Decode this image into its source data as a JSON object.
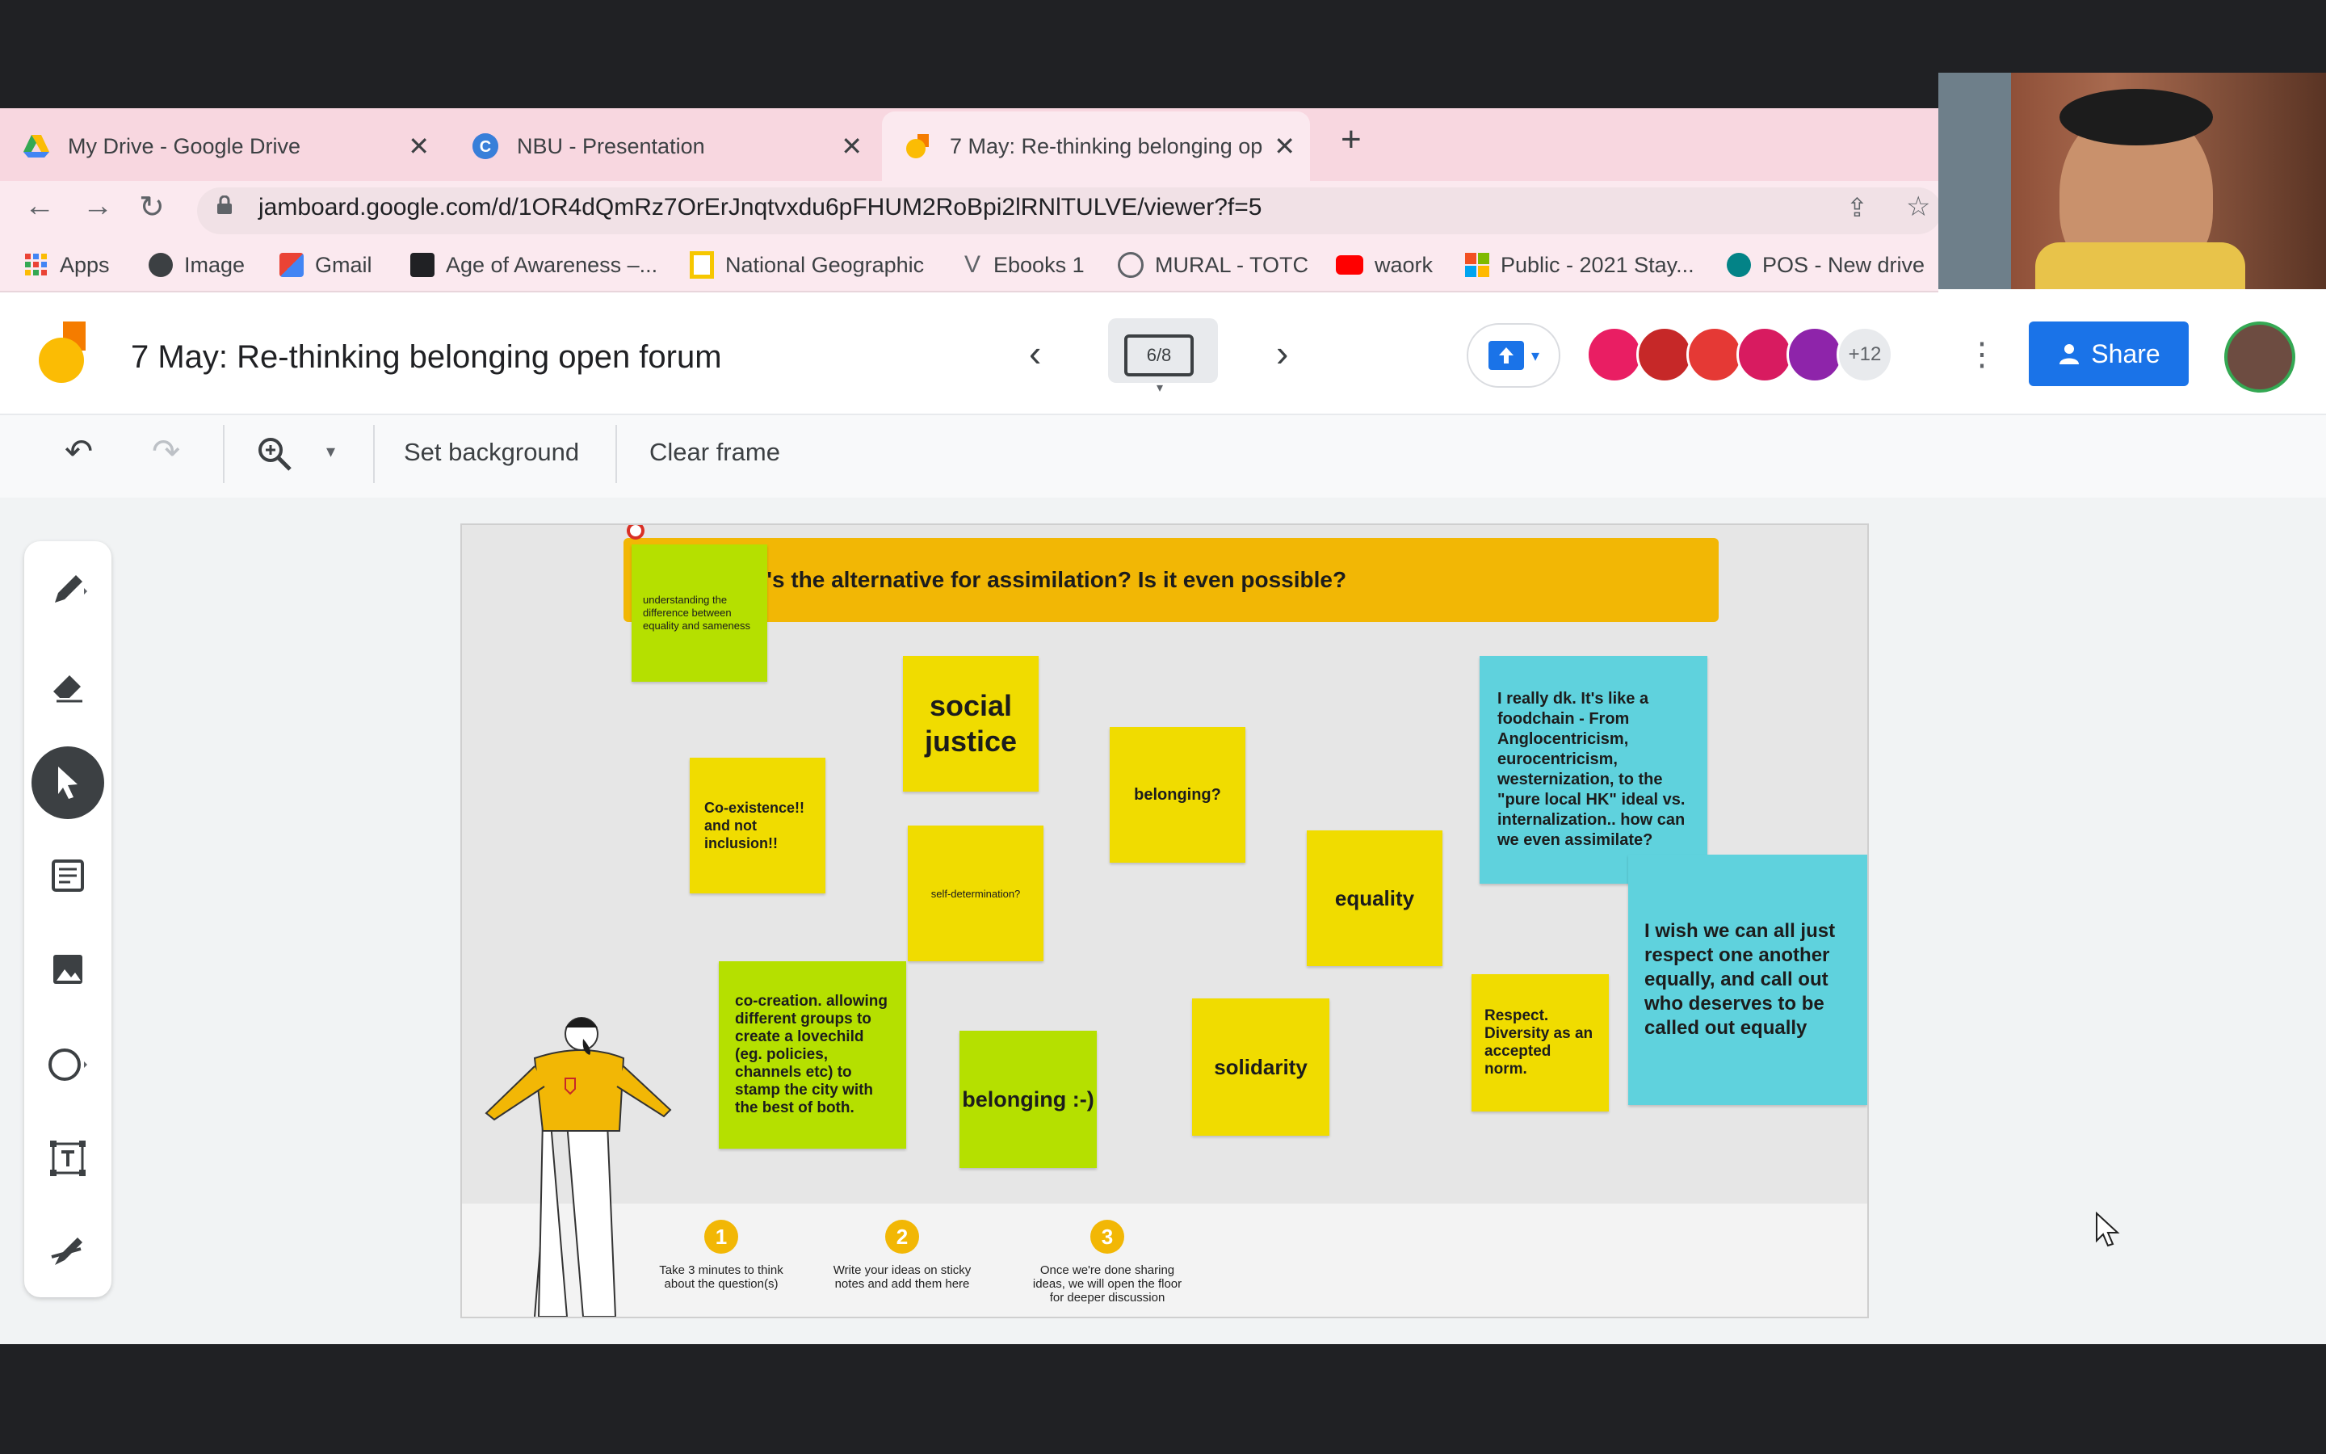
{
  "browser": {
    "tabs": [
      {
        "title": "My Drive - Google Drive",
        "icon": "google-drive-icon",
        "active": false
      },
      {
        "title": "NBU - Presentation",
        "icon": "canva-icon",
        "active": false
      },
      {
        "title": "7 May: Re-thinking belonging op",
        "icon": "jamboard-icon",
        "active": true
      }
    ],
    "new_tab": "+",
    "url": "jamboard.google.com/d/1OR4dQmRz7OrErJnqtvxdu6pFHUM2RoBpi2lRNlTULVE/viewer?f=5",
    "bookmarks": [
      {
        "label": "Apps",
        "icon": "apps-grid-icon",
        "color": "#ea4335"
      },
      {
        "label": "Image",
        "icon": "globe-icon",
        "color": "#3c4043"
      },
      {
        "label": "Gmail",
        "icon": "gmail-icon",
        "color": "#ea4335"
      },
      {
        "label": "Age of Awareness –...",
        "icon": "medium-icon",
        "color": "#202124"
      },
      {
        "label": "National Geographic",
        "icon": "natgeo-icon",
        "color": "#f6c700"
      },
      {
        "label": "Ebooks 1",
        "icon": "v-icon",
        "color": "#5f6368"
      },
      {
        "label": "MURAL - TOTC",
        "icon": "mural-icon",
        "color": "#5f6368"
      },
      {
        "label": "waork",
        "icon": "youtube-icon",
        "color": "#ff0000"
      },
      {
        "label": "Public - 2021 Stay...",
        "icon": "microsoft-icon",
        "color": "#f25022"
      },
      {
        "label": "POS - New drive",
        "icon": "sharepoint-icon",
        "color": "#038387"
      }
    ]
  },
  "jamboard": {
    "title": "7 May: Re-thinking belonging open forum",
    "frame_indicator": "6/8",
    "extra_collaborators": "+12",
    "share_label": "Share",
    "toolbar": {
      "set_background": "Set background",
      "clear_frame": "Clear frame"
    },
    "collaborator_colors": [
      "#e91e63",
      "#c62828",
      "#e53935",
      "#d81b60",
      "#8e24aa"
    ]
  },
  "board": {
    "banner": "t's the alternative for assimilation? Is it even possible?",
    "notes": {
      "understanding": "understanding the difference between equality and sameness",
      "social_justice": "social justice",
      "coexistence": "Co-existence!! and not inclusion!!",
      "belonging_q": "belonging?",
      "self_determination": "self-determination?",
      "foodchain": "I really dk. It's like a foodchain - From Anglocentricism, eurocentricism, westernization, to the \"pure local HK\" ideal vs. internalization.. how can we even assimilate?",
      "equality": "equality",
      "respect_all": "I wish we can all just respect one another equally, and call out who deserves to be called out equally",
      "cocreation": "co-creation. allowing different groups to create a lovechild (eg. policies, channels etc) to stamp the city with the best of both.",
      "belonging_smile": "belonging :-)",
      "solidarity": "solidarity",
      "respect_diversity": "Respect. Diversity as an accepted norm."
    },
    "steps": [
      {
        "num": "1",
        "text": "Take 3 minutes to think about the question(s)"
      },
      {
        "num": "2",
        "text": "Write your ideas on sticky notes and add them here"
      },
      {
        "num": "3",
        "text": "Once we're done sharing ideas, we will open the floor for deeper discussion"
      }
    ]
  }
}
